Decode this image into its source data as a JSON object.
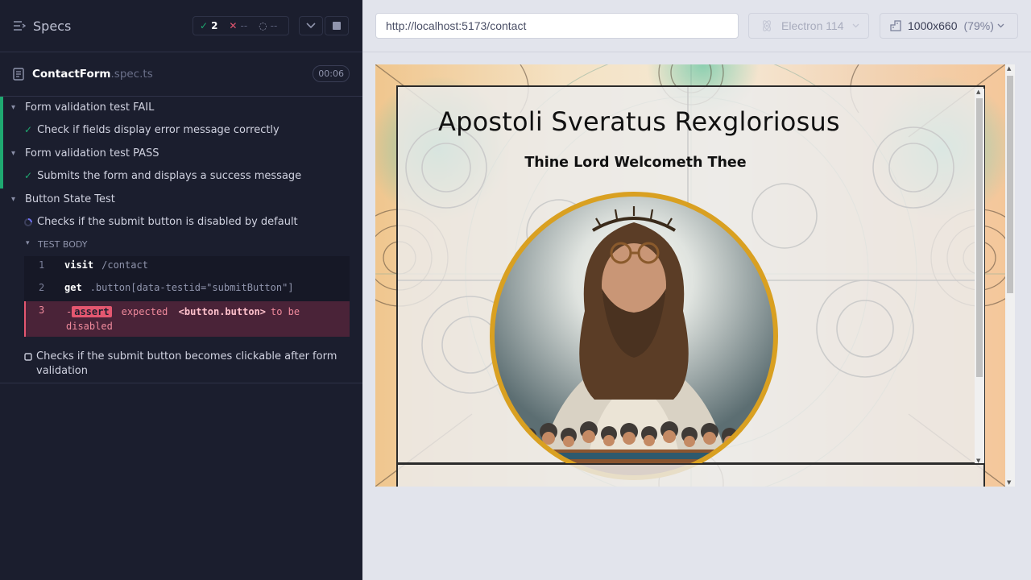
{
  "reporter": {
    "header": {
      "title": "Specs",
      "passed_count": "2",
      "failed_count": "--",
      "pending_count": "--"
    },
    "spec": {
      "name": "ContactForm",
      "ext": ".spec.ts",
      "duration": "00:06"
    },
    "suites": [
      {
        "label": "Form validation test FAIL",
        "tests": [
          {
            "label": "Check if fields display error message correctly",
            "state": "passed"
          }
        ]
      },
      {
        "label": "Form validation test PASS",
        "tests": [
          {
            "label": "Submits the form and displays a success message",
            "state": "passed"
          }
        ]
      },
      {
        "label": "Button State Test",
        "tests": [
          {
            "label": "Checks if the submit button is disabled by default",
            "state": "running"
          },
          {
            "label": "Checks if the submit button becomes clickable after form",
            "label2": "validation",
            "state": "pending"
          }
        ]
      }
    ],
    "test_body_label": "TEST BODY",
    "commands": [
      {
        "num": "1",
        "name": "visit",
        "arg": "/contact"
      },
      {
        "num": "2",
        "name": "get",
        "arg": ".button[data-testid=\"submitButton\"]"
      }
    ],
    "error_command": {
      "num": "3",
      "prefix": "-",
      "name": "assert",
      "text_expected": "expected",
      "text_subject": "<button.button>",
      "text_tobe": "to be",
      "text_state": "disabled"
    }
  },
  "aut": {
    "url": "http://localhost:5173/contact",
    "browser": "Electron 114",
    "viewport": "1000x660",
    "scale": "(79%)",
    "page": {
      "title": "Apostoli Sveratus Rexgloriosus",
      "subtitle": "Thine Lord Welcometh Thee"
    }
  },
  "colors": {
    "pass": "#1fa971",
    "fail": "#e45770",
    "panel_bg": "#1b1e2e",
    "aut_bg": "#e2e4ec"
  }
}
